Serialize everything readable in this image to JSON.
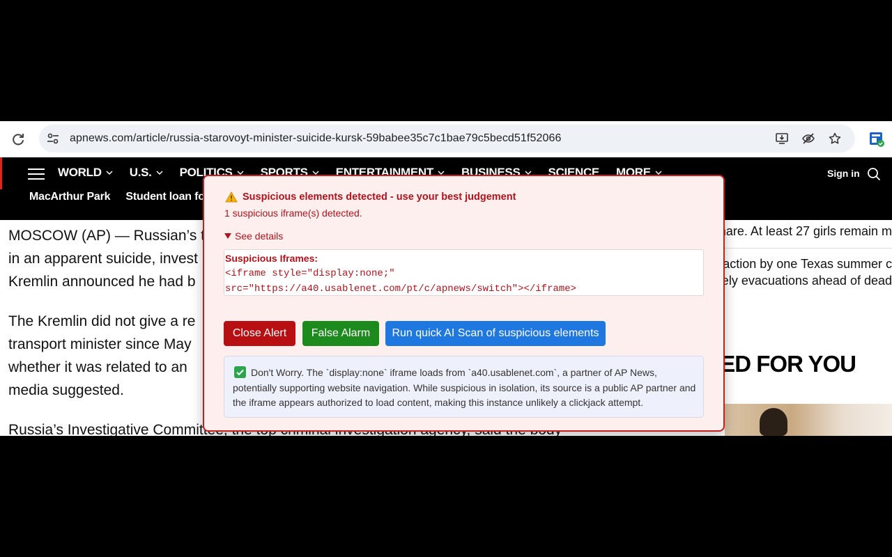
{
  "browser": {
    "url": "apnews.com/article/russia-starovoyt-minister-suicide-kursk-59babee35c7c1bae79c5becd51f52066"
  },
  "ap_nav": {
    "items": [
      {
        "label": "WORLD",
        "has_chevron": true
      },
      {
        "label": "U.S.",
        "has_chevron": true
      },
      {
        "label": "POLITICS",
        "has_chevron": true
      },
      {
        "label": "SPORTS",
        "has_chevron": true
      },
      {
        "label": "ENTERTAINMENT",
        "has_chevron": true
      },
      {
        "label": "BUSINESS",
        "has_chevron": true
      },
      {
        "label": "SCIENCE",
        "has_chevron": false
      },
      {
        "label": "MORE",
        "has_chevron": true
      }
    ],
    "sign_in": "Sign in",
    "trending": [
      "MacArthur Park",
      "Student loan for"
    ]
  },
  "article": {
    "paragraphs": [
      [
        "MOSCOW (AP) — Russian’s t",
        "in an apparent suicide, invest",
        "Kremlin announced he had b"
      ],
      [
        "The Kremlin did not give a re",
        "transport minister since May",
        "whether it was related to an",
        "media suggested."
      ],
      [
        "Russia’s Investigative Committee, the top criminal investigation agency, said the body"
      ]
    ]
  },
  "sidebar": {
    "lines": [
      "mare. At least 27 girls remain m",
      "k action by one Texas summer c",
      "nely evacuations ahead of dead"
    ],
    "suggested_heading": "ESTED FOR YOU"
  },
  "alert": {
    "title": "Suspicious elements detected - use your best judgement",
    "subtitle": "1 suspicious iframe(s) detected.",
    "details_toggle": "See details",
    "iframes_label": "Suspicious Iframes:",
    "iframe_code_line1": "<iframe style=\"display:none;\"",
    "iframe_code_line2": "src=\"https://a40.usablenet.com/pt/c/apnews/switch\"></iframe>",
    "buttons": {
      "close": "Close Alert",
      "false_alarm": "False Alarm",
      "scan": "Run quick AI Scan of suspicious elements"
    },
    "verdict": "Don't Worry. The `display:none` iframe loads from `a40.usablenet.com`, a partner of AP News, potentially supporting website navigation. While suspicious in isolation, its source is a public AP partner and the iframe appears authorized to load content, making this instance unlikely a clickjack attempt."
  },
  "colors": {
    "alert_red": "#b3121b",
    "close_button": "#b80f12",
    "false_alarm_button": "#1c8a1c",
    "scan_button": "#1f78e0"
  },
  "icons": [
    "reload-icon",
    "site-settings-icon",
    "install-app-icon",
    "eye-off-icon",
    "star-icon",
    "extension-icon",
    "menu-icon",
    "search-icon",
    "warning-icon",
    "check-icon",
    "triangle-down-icon"
  ]
}
